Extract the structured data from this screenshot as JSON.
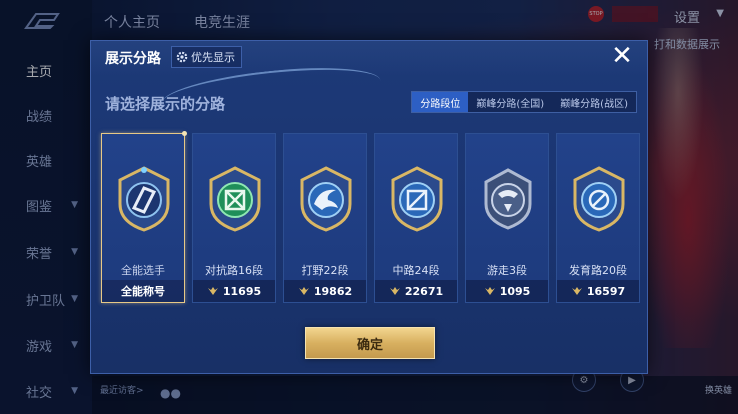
{
  "background": {
    "top_tabs": [
      "个人主页",
      "电竞生涯"
    ],
    "settings_label": "设置",
    "data_button_label": "打和数据展示",
    "sidebar_items": [
      {
        "label": "主页",
        "active": true,
        "has_arrow": false
      },
      {
        "label": "战绩",
        "active": false,
        "has_arrow": false
      },
      {
        "label": "英雄",
        "active": false,
        "has_arrow": false
      },
      {
        "label": "图鉴",
        "active": false,
        "has_arrow": true
      },
      {
        "label": "荣誉",
        "active": false,
        "has_arrow": true
      },
      {
        "label": "护卫队",
        "active": false,
        "has_arrow": true
      },
      {
        "label": "游戏",
        "active": false,
        "has_arrow": true
      },
      {
        "label": "社交",
        "active": false,
        "has_arrow": true
      }
    ],
    "visitor_label": "最近访客>",
    "hero_label": "换英雄",
    "stop_label": "STOP"
  },
  "dialog": {
    "title": "展示分路",
    "priority_label": "优先显示",
    "subtitle": "请选择展示的分路",
    "tabs": [
      {
        "label": "分路段位",
        "active": true
      },
      {
        "label": "巅峰分路(全国)",
        "active": false
      },
      {
        "label": "巅峰分路(战区)",
        "active": false
      }
    ],
    "cards": [
      {
        "rank": "全能选手",
        "footer": "全能称号",
        "selected": true,
        "points_icon": false
      },
      {
        "rank": "对抗路16段",
        "footer": "11695",
        "selected": false,
        "points_icon": true
      },
      {
        "rank": "打野22段",
        "footer": "19862",
        "selected": false,
        "points_icon": true
      },
      {
        "rank": "中路24段",
        "footer": "22671",
        "selected": false,
        "points_icon": true
      },
      {
        "rank": "游走3段",
        "footer": "1095",
        "selected": false,
        "points_icon": true
      },
      {
        "rank": "发育路20段",
        "footer": "16597",
        "selected": false,
        "points_icon": true
      }
    ],
    "confirm_label": "确定"
  },
  "colors": {
    "accent_gold": "#e7c987",
    "tab_active": "#2d5fc4",
    "dialog_bg": "#1d3a78"
  }
}
